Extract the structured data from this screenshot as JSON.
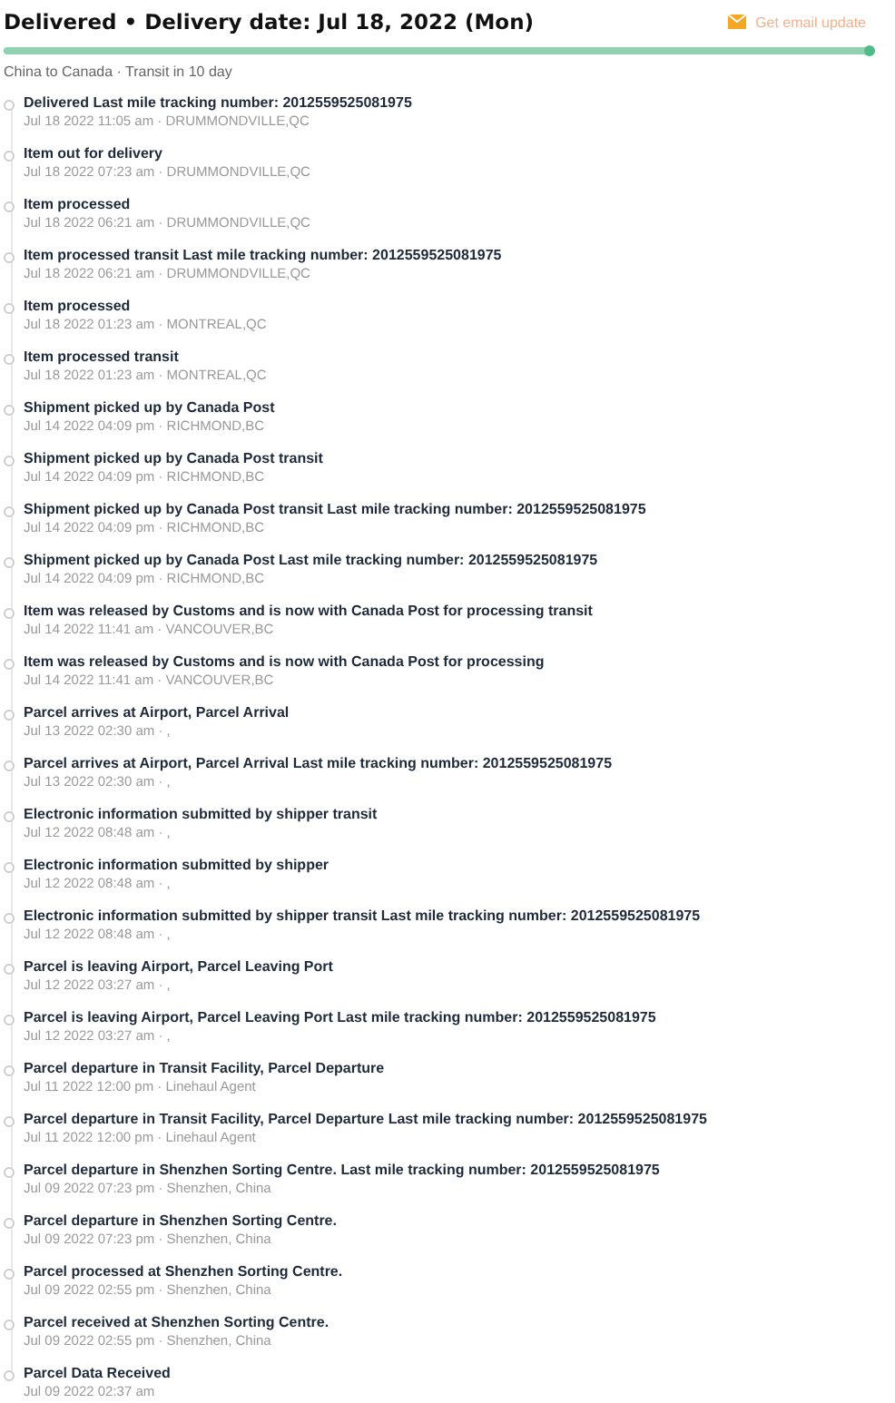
{
  "header": {
    "title": "Delivered • Delivery date: Jul 18, 2022 (Mon)",
    "email_link": "Get email update"
  },
  "progress": {
    "level": 1
  },
  "route": "China to Canada · Transit in 10 day",
  "events": [
    {
      "title": "Delivered Last mile tracking number: 2012559525081975",
      "meta": "Jul 18 2022 11:05 am · DRUMMONDVILLE,QC"
    },
    {
      "title": "Item out for delivery",
      "meta": "Jul 18 2022 07:23 am · DRUMMONDVILLE,QC"
    },
    {
      "title": "Item processed",
      "meta": "Jul 18 2022 06:21 am · DRUMMONDVILLE,QC"
    },
    {
      "title": "Item processed transit Last mile tracking number: 2012559525081975",
      "meta": "Jul 18 2022 06:21 am · DRUMMONDVILLE,QC"
    },
    {
      "title": "Item processed",
      "meta": "Jul 18 2022 01:23 am · MONTREAL,QC"
    },
    {
      "title": "Item processed transit",
      "meta": "Jul 18 2022 01:23 am · MONTREAL,QC"
    },
    {
      "title": "Shipment picked up by Canada Post",
      "meta": "Jul 14 2022 04:09 pm · RICHMOND,BC"
    },
    {
      "title": "Shipment picked up by Canada Post transit",
      "meta": "Jul 14 2022 04:09 pm · RICHMOND,BC"
    },
    {
      "title": "Shipment picked up by Canada Post transit Last mile tracking number: 2012559525081975",
      "meta": "Jul 14 2022 04:09 pm · RICHMOND,BC"
    },
    {
      "title": "Shipment picked up by Canada Post Last mile tracking number: 2012559525081975",
      "meta": "Jul 14 2022 04:09 pm · RICHMOND,BC"
    },
    {
      "title": "Item was released by Customs and is now with Canada Post for processing transit",
      "meta": "Jul 14 2022 11:41 am · VANCOUVER,BC"
    },
    {
      "title": "Item was released by Customs and is now with Canada Post for processing",
      "meta": "Jul 14 2022 11:41 am · VANCOUVER,BC"
    },
    {
      "title": "Parcel arrives at Airport, Parcel Arrival",
      "meta": "Jul 13 2022 02:30 am · ,"
    },
    {
      "title": "Parcel arrives at Airport, Parcel Arrival Last mile tracking number: 2012559525081975",
      "meta": "Jul 13 2022 02:30 am · ,"
    },
    {
      "title": "Electronic information submitted by shipper transit",
      "meta": "Jul 12 2022 08:48 am · ,"
    },
    {
      "title": "Electronic information submitted by shipper",
      "meta": "Jul 12 2022 08:48 am · ,"
    },
    {
      "title": "Electronic information submitted by shipper transit Last mile tracking number: 2012559525081975",
      "meta": "Jul 12 2022 08:48 am · ,"
    },
    {
      "title": "Parcel is leaving Airport, Parcel Leaving Port",
      "meta": "Jul 12 2022 03:27 am · ,"
    },
    {
      "title": "Parcel is leaving Airport, Parcel Leaving Port Last mile tracking number: 2012559525081975",
      "meta": "Jul 12 2022 03:27 am · ,"
    },
    {
      "title": "Parcel departure in Transit Facility, Parcel Departure",
      "meta": "Jul 11 2022 12:00 pm · Linehaul Agent"
    },
    {
      "title": "Parcel departure in Transit Facility, Parcel Departure Last mile tracking number: 2012559525081975",
      "meta": "Jul 11 2022 12:00 pm · Linehaul Agent"
    },
    {
      "title": "Parcel departure in Shenzhen Sorting Centre. Last mile tracking number: 2012559525081975",
      "meta": "Jul 09 2022 07:23 pm · Shenzhen, China"
    },
    {
      "title": "Parcel departure in Shenzhen Sorting Centre.",
      "meta": "Jul 09 2022 07:23 pm · Shenzhen, China"
    },
    {
      "title": "Parcel processed at Shenzhen Sorting Centre.",
      "meta": "Jul 09 2022 02:55 pm · Shenzhen, China"
    },
    {
      "title": "Parcel received at Shenzhen Sorting Centre.",
      "meta": "Jul 09 2022 02:55 pm · Shenzhen, China"
    },
    {
      "title": "Parcel Data Received",
      "meta": "Jul 09 2022 02:37 am"
    }
  ]
}
